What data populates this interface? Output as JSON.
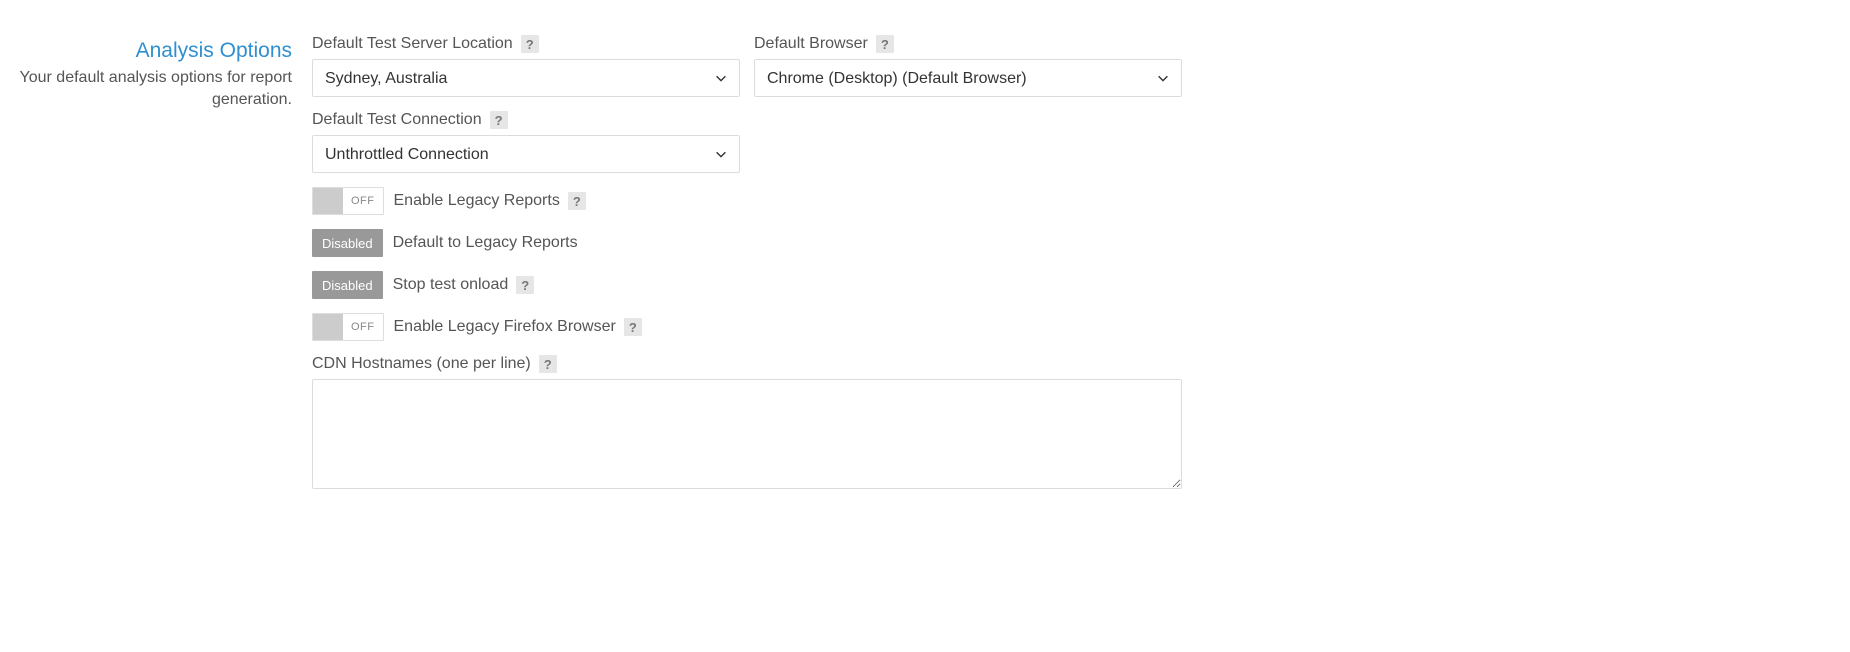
{
  "section": {
    "title": "Analysis Options",
    "description": "Your default analysis options for report generation."
  },
  "fields": {
    "server_location": {
      "label": "Default Test Server Location",
      "value": "Sydney, Australia"
    },
    "browser": {
      "label": "Default Browser",
      "value": "Chrome (Desktop) (Default Browser)"
    },
    "connection": {
      "label": "Default Test Connection",
      "value": "Unthrottled Connection"
    },
    "toggles": {
      "enable_legacy_reports": {
        "state": "OFF",
        "label": "Enable Legacy Reports"
      },
      "default_legacy_reports": {
        "state": "Disabled",
        "label": "Default to Legacy Reports"
      },
      "stop_test_onload": {
        "state": "Disabled",
        "label": "Stop test onload"
      },
      "enable_legacy_firefox": {
        "state": "OFF",
        "label": "Enable Legacy Firefox Browser"
      }
    },
    "cdn_hostnames": {
      "label": "CDN Hostnames (one per line)",
      "value": ""
    }
  },
  "help_symbol": "?"
}
